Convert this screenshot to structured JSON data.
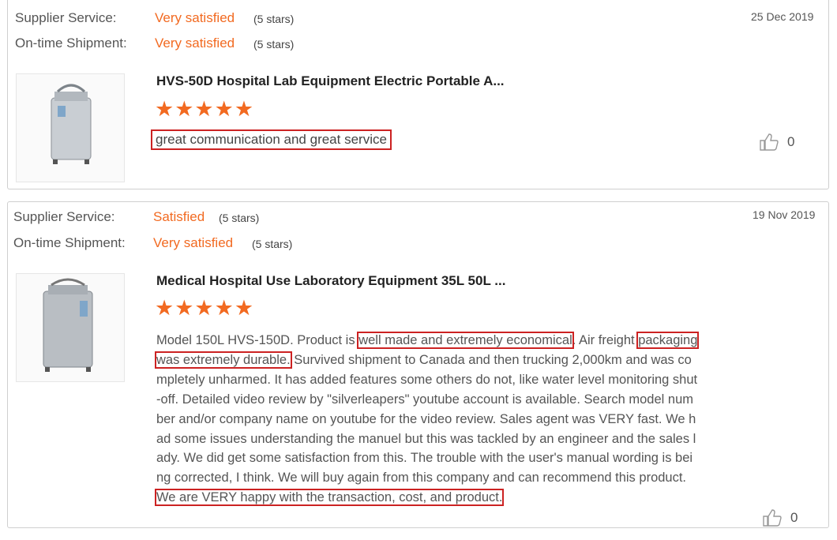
{
  "reviews": [
    {
      "supplier_label": "Supplier Service:",
      "supplier_value": "Very satisfied",
      "supplier_stars": "(5 stars)",
      "shipment_label": "On-time Shipment:",
      "shipment_value": "Very satisfied",
      "shipment_stars": "(5 stars)",
      "date": "25 Dec 2019",
      "product_title": "HVS-50D Hospital Lab Equipment Electric Portable A...",
      "rating": "★★★★★",
      "rating_value": 5,
      "comment": "great communication and great service",
      "likes": "0",
      "icon": "thumbs-up-icon"
    },
    {
      "supplier_label": "Supplier Service:",
      "supplier_value": "Satisfied",
      "supplier_stars": "(5 stars)",
      "shipment_label": "On-time Shipment:",
      "shipment_value": "Very satisfied",
      "shipment_stars": "(5 stars)",
      "date": "19 Nov 2019",
      "product_title": "Medical Hospital Use Laboratory Equipment 35L 50L ...",
      "rating": "★★★★★",
      "rating_value": 5,
      "comment_parts": [
        "Model 150L HVS-150D. Product is ",
        "well made and extremely economical",
        ". Air freight ",
        "packaging was extremely durable.",
        " Survived shipment to Canada and then trucking 2,000km and was completely unharmed. It has added features some others do not, like water level monitoring shut-off. Detailed video review by \"silverleapers\" youtube account is available. Search model number and/or company name on youtube for the video review. Sales agent was VERY fast. We had some issues understanding the manuel but this was tackled by an engineer and the sales lady. We did get some satisfaction from this. The trouble with the user's manual wording is being corrected, I think. We will buy again from this company and can recommend this product. ",
        "We are VERY happy with the transaction, cost, and product."
      ],
      "likes": "0",
      "icon": "thumbs-up-icon"
    }
  ],
  "colors": {
    "accent": "#f26a21",
    "highlight_border": "#cc2222"
  }
}
